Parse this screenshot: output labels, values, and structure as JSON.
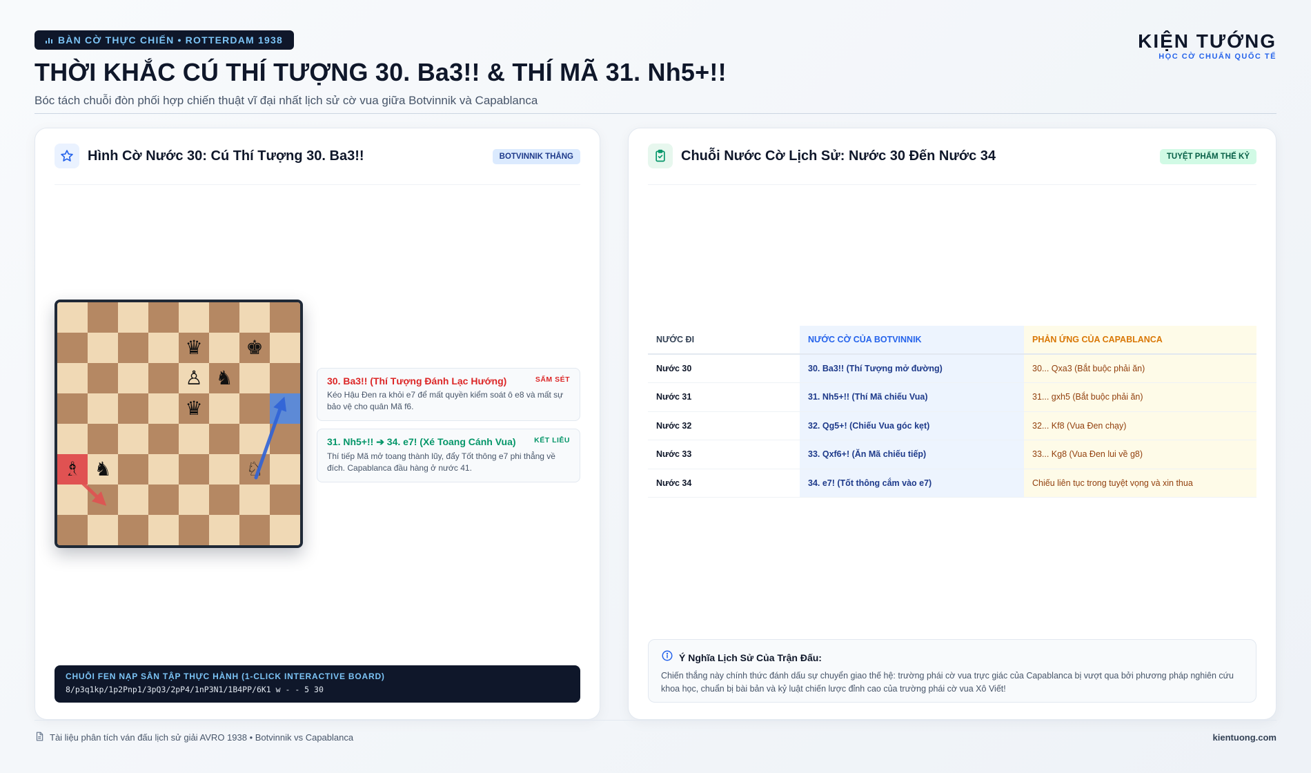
{
  "header": {
    "tag": "BÀN CỜ THỰC CHIẾN • ROTTERDAM 1938",
    "title": "THỜI KHẮC CÚ THÍ TƯỢNG 30. Ba3!! & THÍ MÃ 31. Nh5+!!",
    "subtitle": "Bóc tách chuỗi đòn phối hợp chiến thuật vĩ đại nhất lịch sử cờ vua giữa Botvinnik và Capablanca",
    "brand_name": "KIỆN TƯỚNG",
    "brand_sub": "HỌC CỜ CHUẨN QUỐC TẾ"
  },
  "left": {
    "title": "Hình Cờ Nước 30: Cú Thí Tượng 30. Ba3!!",
    "badge": "BOTVINNIK THẮNG",
    "board": {
      "rows": [
        [
          "",
          "",
          "",
          "",
          "",
          "",
          "",
          ""
        ],
        [
          "",
          "",
          "",
          "",
          "♛",
          "",
          "♚",
          ""
        ],
        [
          "",
          "",
          "",
          "",
          "♙",
          "♞",
          "",
          ""
        ],
        [
          "",
          "",
          "",
          "",
          "♛",
          "",
          "",
          ""
        ],
        [
          "",
          "",
          "",
          "",
          "",
          "",
          "",
          ""
        ],
        [
          "♗",
          "♞",
          "",
          "",
          "",
          "",
          "♘",
          ""
        ],
        [
          "",
          "",
          "",
          "",
          "",
          "",
          "",
          ""
        ],
        [
          "",
          "",
          "",
          "",
          "",
          "",
          "",
          ""
        ]
      ],
      "highlight_red": "a3",
      "highlight_blue": "h5",
      "arrow_red": "a3-b2",
      "arrow_blue": "g3-h5",
      "arrow_red_color": "#e05252",
      "arrow_blue_color": "#2f63d8"
    },
    "notes": [
      {
        "title": "30. Ba3!! (Thí Tượng Đánh Lạc Hướng)",
        "tag": "SẤM SÉT",
        "body": "Kéo Hậu Đen ra khỏi e7 để mất quyền kiểm soát ô e8 và mất sự bảo vệ cho quân Mã f6."
      },
      {
        "title": "31. Nh5+!! ➔ 34. e7! (Xé Toang Cánh Vua)",
        "tag": "KẾT LIỄU",
        "body": "Thí tiếp Mã mở toang thành lũy, đẩy Tốt thông e7 phi thẳng về đích. Capablanca đầu hàng ở nước 41."
      }
    ],
    "fen_label": "CHUỖI FEN NẠP SÂN TẬP THỰC HÀNH (1-CLICK INTERACTIVE BOARD)",
    "fen_value": "8/p3q1kp/1p2Pnp1/3pQ3/2pP4/1nP3N1/1B4PP/6K1 w - - 5 30"
  },
  "right": {
    "title": "Chuỗi Nước Cờ Lịch Sử: Nước 30 Đến Nước 34",
    "badge": "TUYỆT PHẨM THẾ KỶ",
    "table": {
      "headers": [
        "NƯỚC ĐI",
        "NƯỚC CỜ CỦA BOTVINNIK",
        "PHẢN ỨNG CỦA CAPABLANCA"
      ],
      "rows": [
        [
          "Nước 30",
          "30. Ba3!! (Thí Tượng mở đường)",
          "30... Qxa3 (Bắt buộc phải ăn)"
        ],
        [
          "Nước 31",
          "31. Nh5+!! (Thí Mã chiếu Vua)",
          "31... gxh5 (Bắt buộc phải ăn)"
        ],
        [
          "Nước 32",
          "32. Qg5+! (Chiếu Vua góc kẹt)",
          "32... Kf8 (Vua Đen chạy)"
        ],
        [
          "Nước 33",
          "33. Qxf6+! (Ăn Mã chiếu tiếp)",
          "33... Kg8 (Vua Đen lui về g8)"
        ],
        [
          "Nước 34",
          "34. e7! (Tốt thông cắm vào e7)",
          "Chiếu liên tục trong tuyệt vọng và xin thua"
        ]
      ]
    },
    "meaning_title": "Ý Nghĩa Lịch Sử Của Trận Đấu:",
    "meaning_body": "Chiến thắng này chính thức đánh dấu sự chuyển giao thế hệ: trường phái cờ vua trực giác của Capablanca bị vượt qua bởi phương pháp nghiên cứu khoa học, chuẩn bị bài bản và kỷ luật chiến lược đỉnh cao của trường phái cờ vua Xô Viết!"
  },
  "footer": {
    "left": "Tài liệu phân tích ván đấu lịch sử giải AVRO 1938 • Botvinnik vs Capablanca",
    "right": "kientuong.com"
  },
  "colors": {
    "accent": "#2563eb",
    "dark": "#0f172a",
    "light_square": "#f0d9b5",
    "dark_square": "#b58863"
  }
}
